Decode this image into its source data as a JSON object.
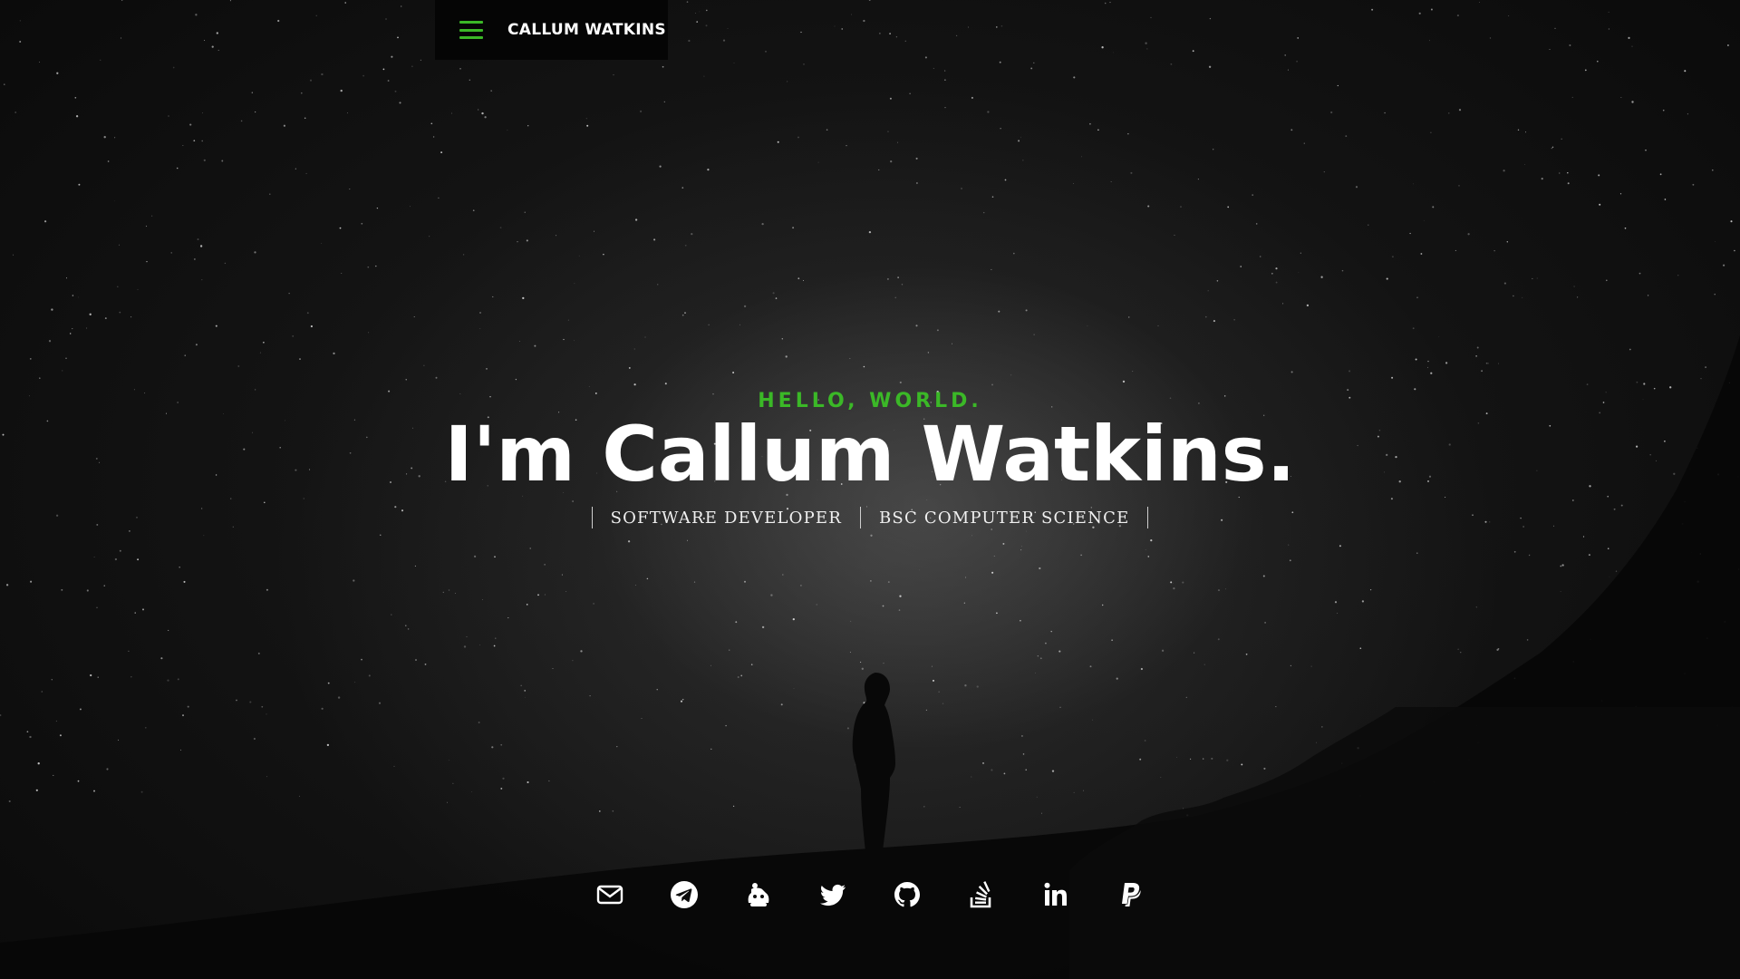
{
  "navbar": {
    "brand": "CALLUM WATKINS",
    "menu_icon": "hamburger-menu-icon",
    "accent": "#3bb827"
  },
  "intro": {
    "greeting": "HELLO, WORLD.",
    "headline": "I'm Callum Watkins.",
    "roles": [
      "SOFTWARE DEVELOPER",
      "BSC COMPUTER SCIENCE"
    ]
  },
  "social": [
    {
      "icon": "email-icon"
    },
    {
      "icon": "telegram-icon"
    },
    {
      "icon": "bot-icon"
    },
    {
      "icon": "twitter-icon"
    },
    {
      "icon": "github-icon"
    },
    {
      "icon": "stackoverflow-icon"
    },
    {
      "icon": "linkedin-icon"
    },
    {
      "icon": "paypal-icon"
    }
  ],
  "colors": {
    "background": "#0d0d0d",
    "accent": "#3bb827",
    "text": "#ffffff"
  }
}
